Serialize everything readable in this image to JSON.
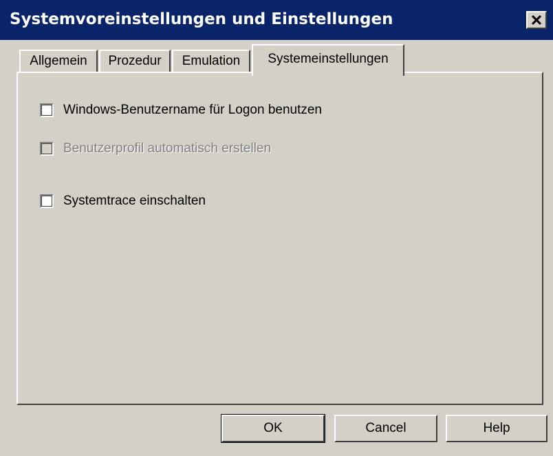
{
  "window": {
    "title": "Systemvoreinstellungen und Einstellungen"
  },
  "tabs": [
    {
      "label": "Allgemein",
      "active": false
    },
    {
      "label": "Prozedur",
      "active": false
    },
    {
      "label": "Emulation",
      "active": false
    },
    {
      "label": "Systemeinstellungen",
      "active": true
    }
  ],
  "settings": {
    "windows_username": {
      "label": "Windows-Benutzername für Logon benutzen",
      "checked": false,
      "enabled": true
    },
    "auto_profile": {
      "label": "Benutzerprofil automatisch erstellen",
      "checked": false,
      "enabled": false
    },
    "systemtrace": {
      "label": "Systemtrace einschalten",
      "checked": false,
      "enabled": true
    }
  },
  "buttons": {
    "ok": "OK",
    "cancel": "Cancel",
    "help": "Help"
  },
  "colors": {
    "titlebar": "#0a246a",
    "face": "#d4d0c8"
  }
}
